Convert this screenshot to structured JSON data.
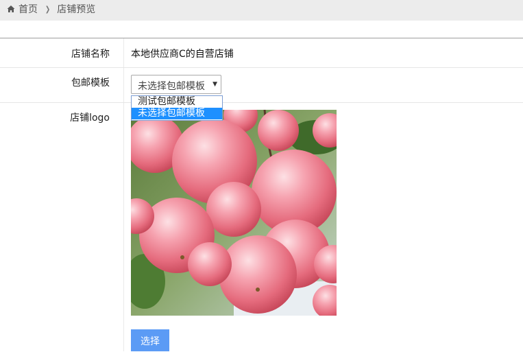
{
  "breadcrumb": {
    "home": "首页",
    "current": "店铺预览"
  },
  "form": {
    "shop_name_label": "店铺名称",
    "shop_name_value": "本地供应商C的自营店铺",
    "shipping_label": "包邮模板",
    "shipping_selected": "未选择包邮模板",
    "shipping_options": [
      "测试包邮模板",
      "未选择包邮模板"
    ],
    "logo_label_cn": "店铺",
    "logo_label_en": "logo",
    "choose_button": "选择"
  },
  "colors": {
    "accent": "#5b9bf5",
    "option_highlight": "#1e90ff",
    "topbar": "#ececec"
  },
  "icons": {
    "home": "home-icon",
    "breadcrumb_sep": "chevron-right-icon",
    "select_arrow": "caret-down-icon"
  }
}
